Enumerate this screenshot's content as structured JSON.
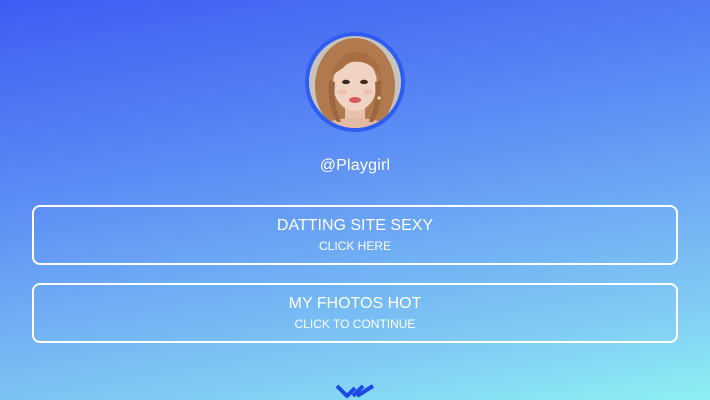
{
  "profile": {
    "username": "@Playgirl",
    "avatar_icon": "profile-photo",
    "avatar_ring_color": "#2d5df1"
  },
  "links": [
    {
      "title": "DATTING SITE SEXY",
      "subtitle": "CLICK HERE"
    },
    {
      "title": "MY FHOTOS HOT",
      "subtitle": "CLICK TO CONTINUE"
    }
  ],
  "scroll_indicator": {
    "icon": "double-chevron-down-icon",
    "color": "#1e47e6"
  },
  "theme": {
    "gradient_top": "#3f5cf3",
    "gradient_bottom": "#8ff0f4",
    "button_border": "#ffffff"
  }
}
